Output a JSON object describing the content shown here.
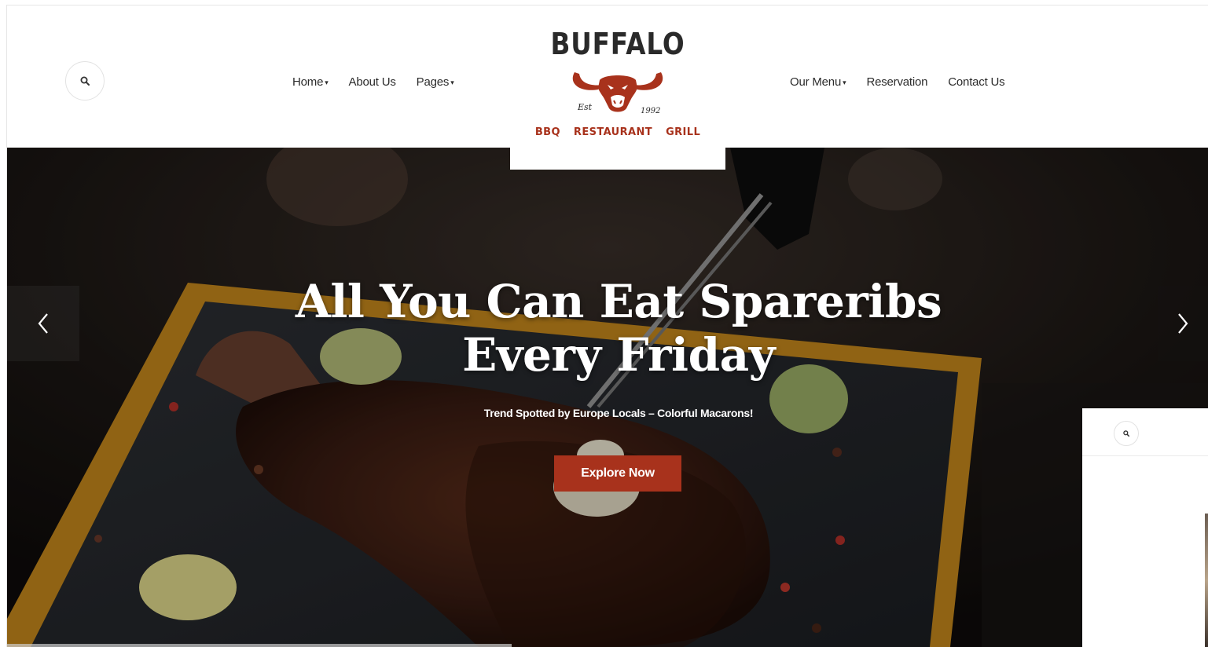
{
  "nav_left": [
    {
      "label": "Home",
      "has_caret": true,
      "active": true
    },
    {
      "label": "About Us",
      "has_caret": false,
      "active": false
    },
    {
      "label": "Pages",
      "has_caret": true,
      "active": false
    }
  ],
  "nav_right": [
    {
      "label": "Our Menu",
      "has_caret": true,
      "active": false
    },
    {
      "label": "Reservation",
      "has_caret": false,
      "active": false
    },
    {
      "label": "Contact Us",
      "has_caret": false,
      "active": false
    }
  ],
  "caret_glyph": "▾",
  "logo": {
    "word": "BUFFALO",
    "est": "Est",
    "year": "1992",
    "tags": [
      "BBQ",
      "RESTAURANT",
      "GRILL"
    ]
  },
  "hero": {
    "title_line1": "All You Can Eat Spareribs",
    "title_line2": "Every Friday",
    "subtitle": "Trend Spotted by Europe Locals – Colorful Macarons!",
    "button_label": "Explore Now"
  },
  "colors": {
    "accent": "#a8321c",
    "nav_text": "#2b2b2b"
  },
  "icons": {
    "search": "search-icon",
    "prev": "chevron-left-icon",
    "next": "chevron-right-icon"
  }
}
